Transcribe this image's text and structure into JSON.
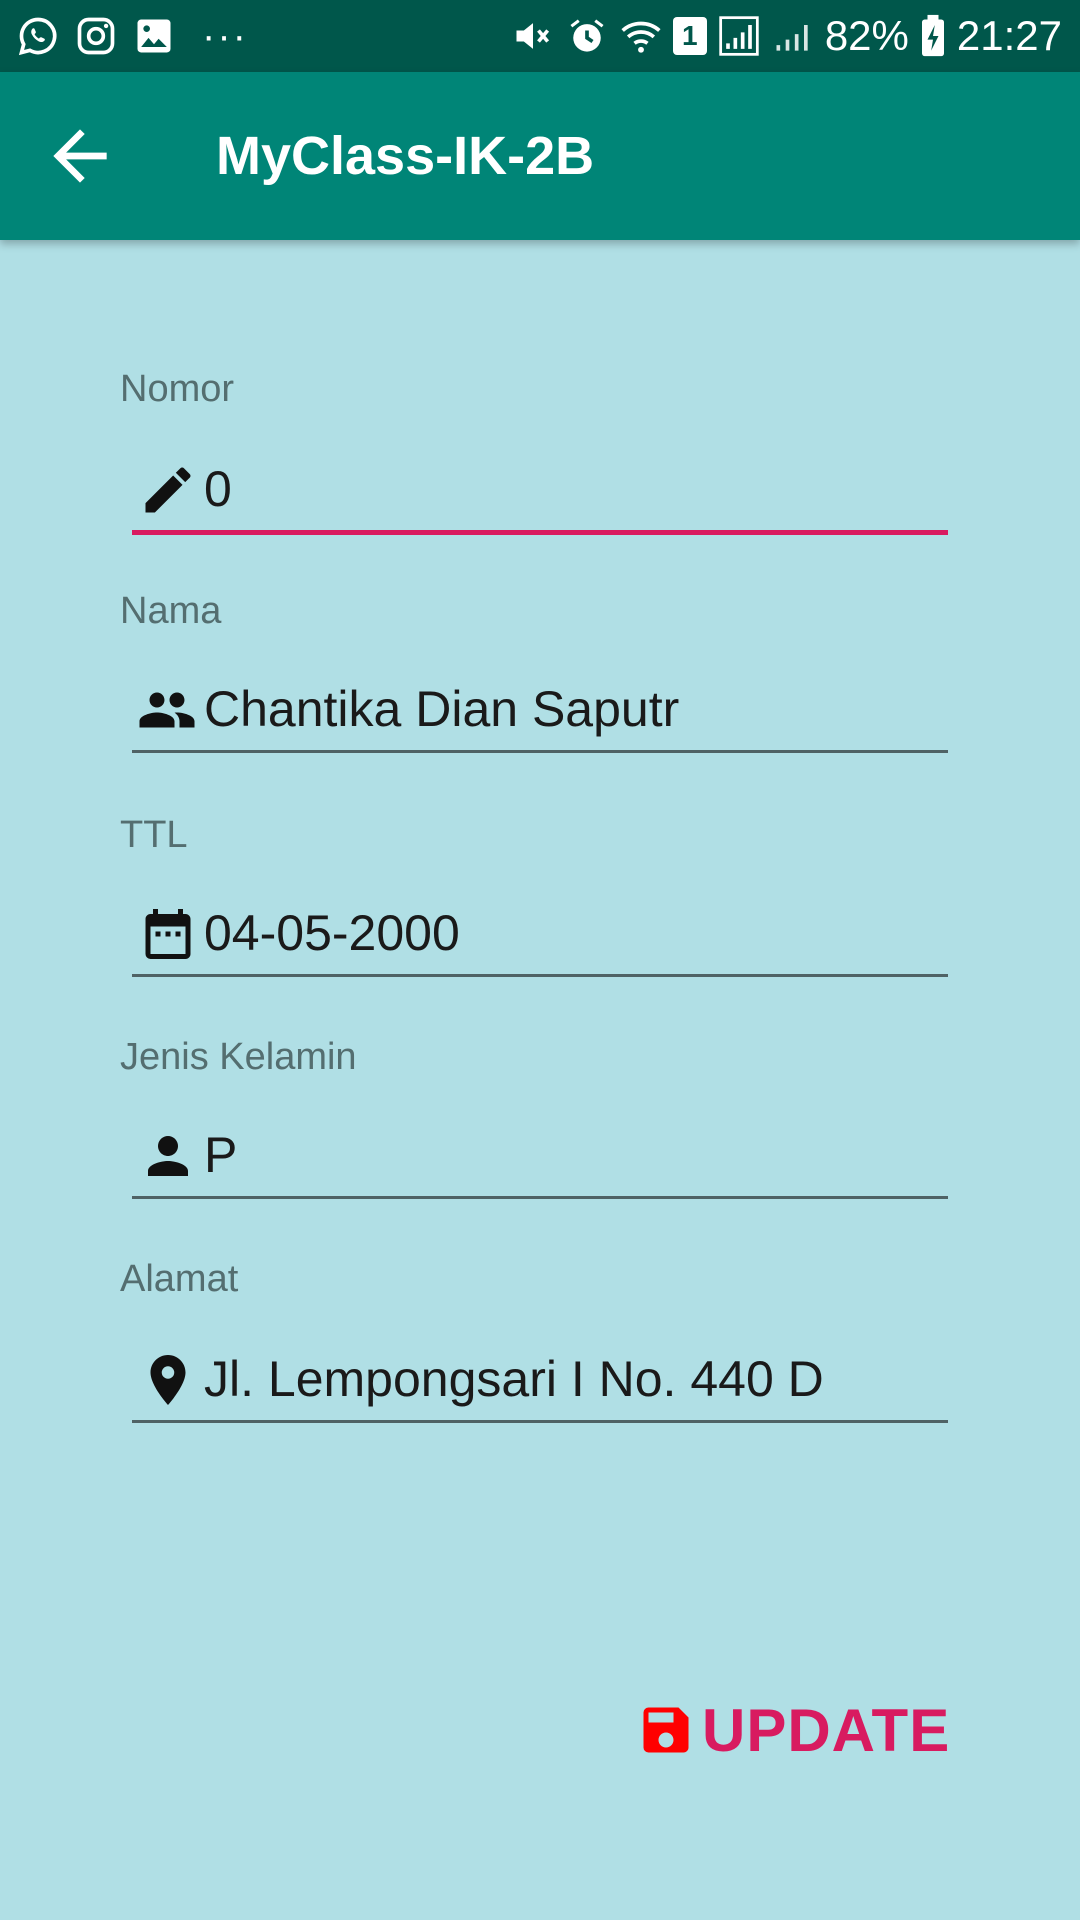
{
  "status_bar": {
    "left_icons": [
      "whatsapp-icon",
      "instagram-icon",
      "gallery-icon"
    ],
    "overflow": "···",
    "sim_slot": "1",
    "battery_percent": "82%",
    "time": "21:27"
  },
  "app_bar": {
    "title": "MyClass-IK-2B"
  },
  "form": {
    "fields": [
      {
        "label": "Nomor",
        "value": "0",
        "icon": "pencil-icon",
        "focused": true
      },
      {
        "label": "Nama",
        "value": "Chantika Dian Saputr",
        "icon": "people-icon"
      },
      {
        "label": "TTL",
        "value": "04-05-2000",
        "icon": "calendar-icon"
      },
      {
        "label": "Jenis Kelamin",
        "value": "P",
        "icon": "person-icon"
      },
      {
        "label": "Alamat",
        "value": "Jl. Lempongsari I No. 440 D",
        "icon": "location-pin-icon"
      }
    ]
  },
  "update_button": {
    "label": "UPDATE",
    "icon": "save-icon"
  },
  "colors": {
    "status_bar": "#00574b",
    "app_bar": "#008577",
    "background": "#b0dfe5",
    "accent": "#d81b60",
    "save_icon": "#ff0000"
  }
}
